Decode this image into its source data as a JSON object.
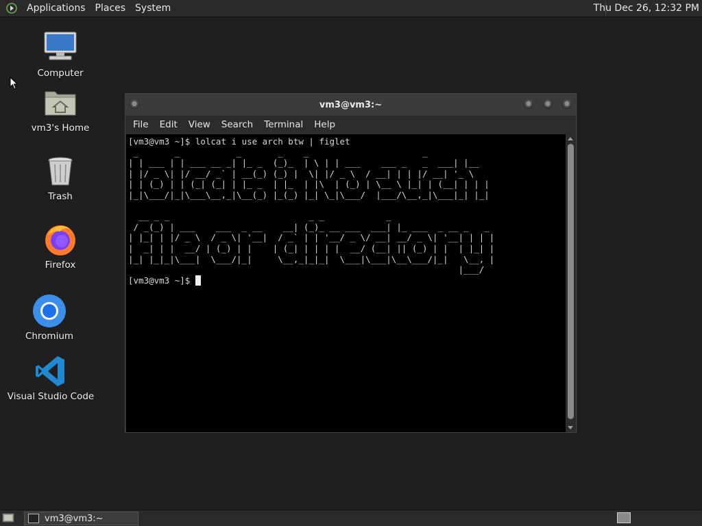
{
  "top_panel": {
    "menus": [
      "Applications",
      "Places",
      "System"
    ],
    "clock": "Thu Dec 26, 12:32 PM"
  },
  "desktop_icons": [
    {
      "label": "Computer",
      "icon": "computer-icon"
    },
    {
      "label": "vm3's Home",
      "icon": "home-folder-icon"
    },
    {
      "label": "Trash",
      "icon": "trash-icon"
    },
    {
      "label": "Firefox",
      "icon": "firefox-icon"
    },
    {
      "label": "Chromium",
      "icon": "chromium-icon"
    },
    {
      "label": "Visual Studio Code",
      "icon": "vscode-icon"
    }
  ],
  "terminal": {
    "title": "vm3@vm3:~",
    "menu": [
      "File",
      "Edit",
      "View",
      "Search",
      "Terminal",
      "Help"
    ],
    "output": "[vm3@vm3 ~]$ lolcat i use arch btw | figlet\n _       _           _       _    _                      _\n| | ___ | | ___ __ _| |_ _  (_)_  | \\ | | ___    ___ _   _  ___| |__\n| |/ _ \\| |/ __/ _` | __(_) (_) |  \\| |/ _ \\  / __| | | |/ __| '_ \\\n| | (_) | | (_| (_| | |_ _  | |_  | |\\  | (_) | \\__ \\ |_| | (__| | | |\n|_|\\___/|_|\\___\\__,_|\\__(_) |_(_) |_| \\_|\\___/  |___/\\__,_|\\___|_| |_|\n\n  __ _ _                           _ _            _\n / _(_) | ___    ___  _ __    __| (_)_ __ ___  ___| |_ ___  _ __ _   _\n| |_| | |/ _ \\  / _ \\| '__|  / _` | | '__/ _ \\/ __| __/ _ \\| '__| | | |\n|  _| | |  __/ | (_) | |    | (_| | | | |  __/ (__| || (_) | |  | |_| |\n|_| |_|_|\\___|  \\___/|_|     \\__,_|_|_|  \\___|\\___|\\__\\___/|_|   \\__, |\n                                                                |___/",
    "prompt": "[vm3@vm3 ~]$ "
  },
  "bottom_panel": {
    "task_label": "vm3@vm3:~"
  }
}
